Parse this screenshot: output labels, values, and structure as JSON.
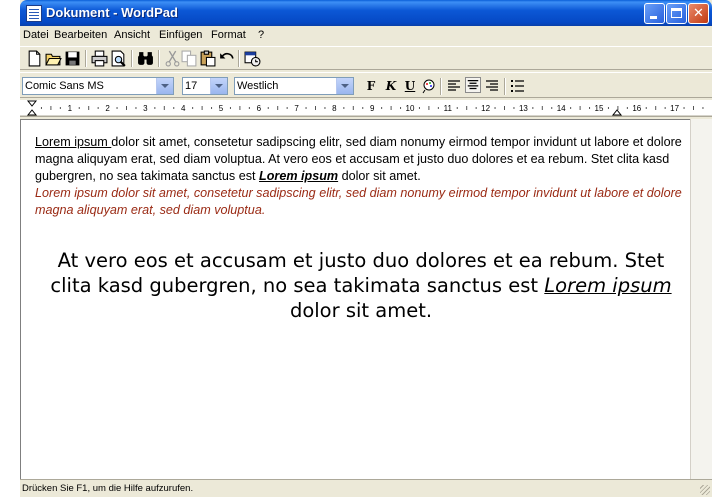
{
  "window": {
    "title": "Dokument - WordPad"
  },
  "menu": [
    "Datei",
    "Bearbeiten",
    "Ansicht",
    "Einfügen",
    "Format",
    "?"
  ],
  "toolbar": {
    "icons": [
      "new-document-icon",
      "open-folder-icon",
      "save-icon",
      "print-icon",
      "print-preview-icon",
      "find-icon",
      "cut-icon",
      "copy-icon",
      "paste-icon",
      "undo-icon",
      "insert-date-time-icon"
    ]
  },
  "format": {
    "font": "Comic Sans MS",
    "size": "17",
    "script": "Westlich",
    "bold_label": "F",
    "italic_label": "K",
    "underline_label": "U"
  },
  "ruler": {
    "labels": [
      "1",
      "2",
      "3",
      "4",
      "5",
      "6",
      "7",
      "8",
      "9",
      "10",
      "11",
      "12",
      "13",
      "14",
      "15",
      "16",
      "17"
    ]
  },
  "document": {
    "p1_link": "Lorem ipsum ",
    "p1_a": "dolor sit amet, consetetur sadipscing elitr, sed diam nonumy eirmod tempor invidunt ut labore et dolore magna aliquyam erat, sed diam voluptua. At vero eos et accusam et justo duo dolores et ea rebum. Stet clita kasd gubergren, no sea takimata sanctus est ",
    "p1_bold": "Lorem ipsum",
    "p1_b": " dolor sit amet.",
    "p1_red": "Lorem ipsum dolor sit amet, consetetur sadipscing elitr, sed diam nonumy eirmod tempor invidunt ut labore et dolore magna aliquyam erat, sed diam voluptua.",
    "p2_a": "At vero eos et accusam et justo duo dolores et ea rebum. Stet clita kasd gubergren, no sea takimata sanctus est ",
    "p2_link": "Lorem ipsum ",
    "p2_b": "dolor sit amet."
  },
  "status": {
    "text": "Drücken Sie F1, um die Hilfe aufzurufen."
  },
  "colors": {
    "titlebar": "#0c58d6",
    "italic_text": "#9a2a14",
    "chrome": "#ece9d8"
  }
}
